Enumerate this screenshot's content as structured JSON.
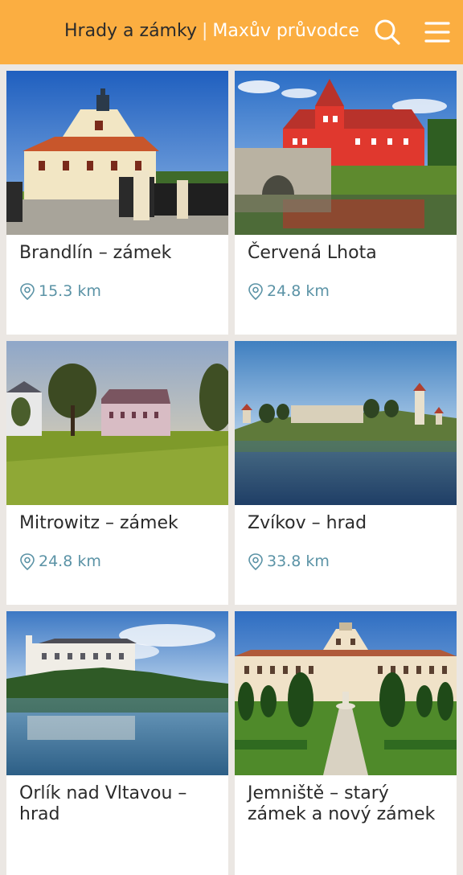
{
  "header": {
    "title": "Hrady a zámky",
    "separator": "|",
    "subtitle": "Maxův průvodce",
    "icons": {
      "search": "search-icon",
      "menu": "hamburger-menu-icon"
    },
    "colors": {
      "bar": "#fbae41",
      "title": "#2b2b2b",
      "subtitle": "#ffffff"
    }
  },
  "places": [
    {
      "name": "Brandlín – zámek",
      "distance": "15.3 km",
      "photo": "manor-house-photo"
    },
    {
      "name": "Červená Lhota",
      "distance": "24.8 km",
      "photo": "red-chateau-lake-photo"
    },
    {
      "name": "Mitrowitz – zámek",
      "distance": "24.8 km",
      "photo": "chateau-park-photo"
    },
    {
      "name": "Zvíkov – hrad",
      "distance": "33.8 km",
      "photo": "castle-river-photo"
    },
    {
      "name": "Orlík nad Vltavou – hrad",
      "distance": "",
      "photo": "castle-reservoir-photo"
    },
    {
      "name": "Jemniště – starý zámek a nový zámek",
      "distance": "",
      "photo": "baroque-chateau-garden-photo"
    }
  ],
  "colors": {
    "distance": "#5b93a6",
    "background": "#ebe7e3"
  }
}
